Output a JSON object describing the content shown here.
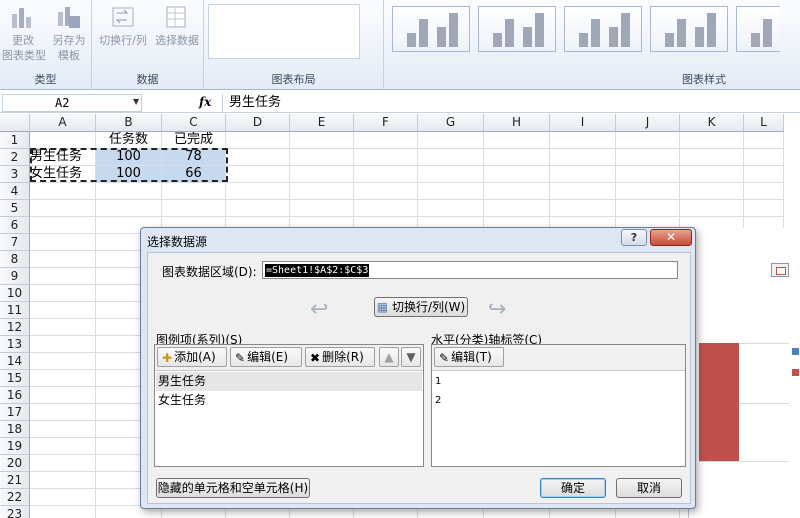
{
  "ribbon": {
    "groups": [
      {
        "label": "类型"
      },
      {
        "label": "数据"
      },
      {
        "label": "图表布局"
      },
      {
        "label": "图表样式"
      }
    ],
    "buttons": {
      "change_type": "更改\n图表类型",
      "save_template": "另存为\n模板",
      "switch_row_col": "切换行/列",
      "select_data": "选择数据"
    }
  },
  "formula_bar": {
    "name_box": "A2",
    "fx_label": "fx",
    "content": "男生任务"
  },
  "sheet": {
    "columns": [
      "A",
      "B",
      "C",
      "D",
      "E",
      "F",
      "G",
      "H",
      "I",
      "J",
      "K",
      "L"
    ],
    "rows": [
      "1",
      "2",
      "3",
      "4",
      "5",
      "6",
      "7",
      "8",
      "9",
      "10",
      "11",
      "12",
      "13",
      "14",
      "15",
      "16",
      "17",
      "18",
      "19",
      "20",
      "21",
      "22",
      "23"
    ],
    "cells": {
      "B1": "任务数",
      "C1": "已完成",
      "A2": "男生任务",
      "B2": "100",
      "C2": "78",
      "A3": "女生任务",
      "B3": "100",
      "C3": "66"
    }
  },
  "colors": {
    "series1": "#4f81bd",
    "series2": "#c0504d",
    "selection": "#c7d9ef",
    "dialog_close": "#c74a33"
  },
  "dialog": {
    "title": "选择数据源",
    "help_glyph": "?",
    "close_glyph": "✕",
    "range_label": "图表数据区域(D):",
    "range_value": "=Sheet1!$A$2:$C$3",
    "switch_button": "切换行/列(W)",
    "legend_panel": {
      "title": "图例项(系列)(S)",
      "add": "添加(A)",
      "edit": "编辑(E)",
      "delete": "删除(R)",
      "items": [
        "男生任务",
        "女生任务"
      ]
    },
    "axis_panel": {
      "title": "水平(分类)轴标签(C)",
      "edit": "编辑(T)",
      "items": [
        "1",
        "2"
      ]
    },
    "hidden_cells_button": "隐藏的单元格和空单元格(H)",
    "ok": "确定",
    "cancel": "取消"
  }
}
